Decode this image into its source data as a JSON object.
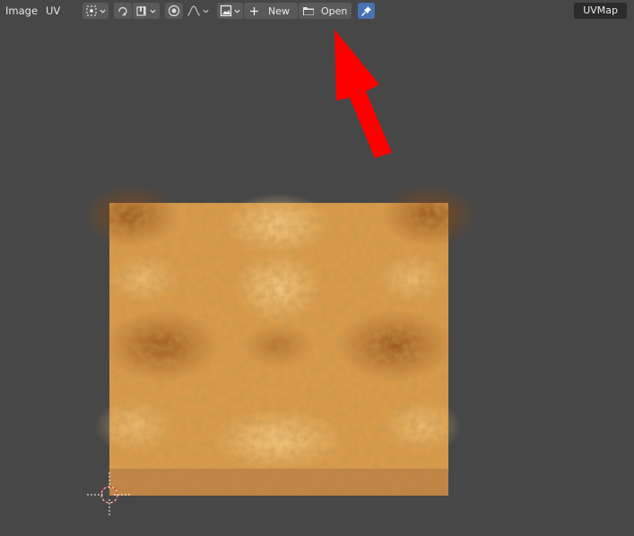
{
  "header": {
    "menus": [
      "Image",
      "UV"
    ],
    "new_label": "New",
    "open_label": "Open",
    "uv_map_label": "UVMap",
    "icons": [
      "pivot-icon",
      "sync-icon",
      "snap-icon",
      "proportional-edit-icon",
      "falloff-icon",
      "image-browse-icon",
      "plus-icon",
      "folder-icon",
      "pin-icon"
    ]
  },
  "colors": {
    "background": "#474747",
    "button": "#5a5a5a",
    "button_active": "#4772b3",
    "annotation_arrow": "#ff0000",
    "texture_base": "#d89a4a"
  }
}
